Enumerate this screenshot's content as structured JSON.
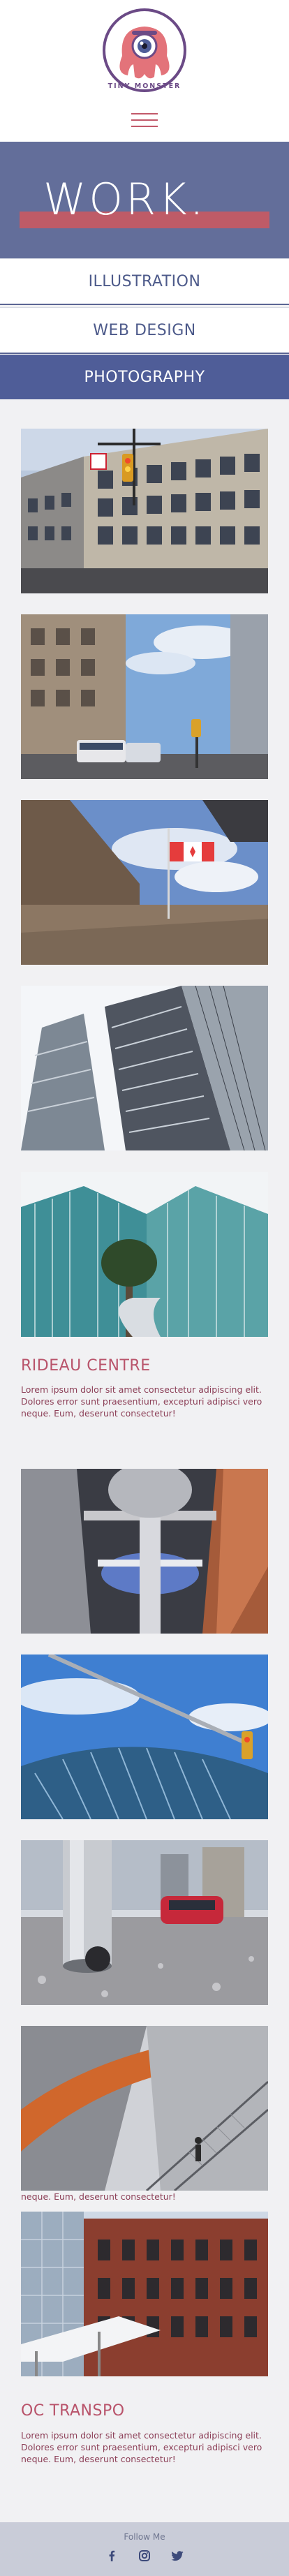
{
  "brand": {
    "name": "TINY MONSTER"
  },
  "nav": {
    "menu_icon": "hamburger-menu-icon"
  },
  "hero": {
    "title": "WORK."
  },
  "tabs": [
    {
      "label": "ILLUSTRATION",
      "active": false
    },
    {
      "label": "WEB DESIGN",
      "active": false
    },
    {
      "label": "PHOTOGRAPHY",
      "active": true
    }
  ],
  "projects": [
    {
      "title": "RIDEAU CENTRE",
      "description": "Lorem ipsum dolor sit amet consectetur adipiscing elit. Dolores error sunt praesentium, excepturi adipisci vero neque. Eum, deserunt consectetur!"
    },
    {
      "caption_fragment": "neque. Eum, deserunt consectetur!"
    },
    {
      "title": "OC TRANSPO",
      "description": "Lorem ipsum dolor sit amet consectetur adipiscing elit. Dolores error sunt praesentium, excepturi adipisci vero neque. Eum, deserunt consectetur!"
    }
  ],
  "footer": {
    "follow_label": "Follow Me",
    "social": [
      "facebook-icon",
      "instagram-icon",
      "twitter-icon"
    ]
  },
  "colors": {
    "accent": "#bf5b67",
    "primary": "#4f5d98",
    "hero": "#636e9a"
  }
}
